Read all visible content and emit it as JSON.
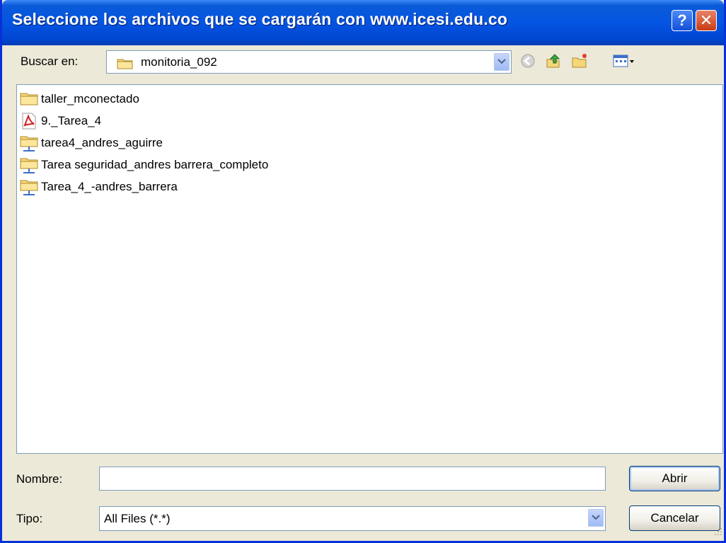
{
  "window": {
    "title": "Seleccione los archivos que se cargarán con www.icesi.edu.co",
    "help_label": "?",
    "close_label": "✕"
  },
  "lookin": {
    "label": "Buscar en:",
    "value": "monitoria_092",
    "icon": "folder-icon"
  },
  "toolbar": {
    "icons": [
      "back-icon",
      "up-folder-icon",
      "new-folder-icon",
      "view-menu-icon"
    ]
  },
  "files": [
    {
      "name": "taller_mconectado",
      "icon": "folder-icon"
    },
    {
      "name": "9._Tarea_4",
      "icon": "pdf-file-icon"
    },
    {
      "name": "tarea4_andres_aguirre",
      "icon": "network-folder-icon"
    },
    {
      "name": "Tarea seguridad_andres barrera_completo",
      "icon": "network-folder-icon"
    },
    {
      "name": "Tarea_4_-andres_barrera",
      "icon": "network-folder-icon"
    }
  ],
  "filename": {
    "label": "Nombre:",
    "value": ""
  },
  "filetype": {
    "label": "Tipo:",
    "value": "All Files (*.*)"
  },
  "buttons": {
    "open": "Abrir",
    "cancel": "Cancelar"
  },
  "colors": {
    "titlebar": "#0555e3",
    "window_bg": "#ece9d8",
    "close_button": "#c73d12",
    "border": "#7f9db9"
  }
}
